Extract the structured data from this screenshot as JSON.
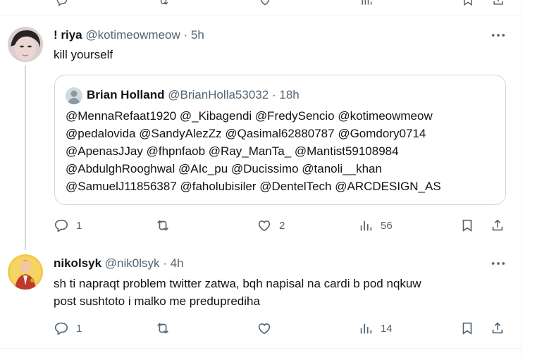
{
  "tweets": [
    {
      "display_name": "! riya",
      "handle": "@kotimeowmeow",
      "separator": "·",
      "time": "5h",
      "text": "kill yourself",
      "quote": {
        "display_name": "Brian Holland",
        "handle": "@BrianHolla53032",
        "separator": "·",
        "time": "18h",
        "lines": [
          "@MennaRefaat1920 @_Kibagendi @FredySencio @kotimeowmeow",
          "@pedalovida @SandyAlezZz @Qasimal62880787 @Gomdory0714",
          "@ApenasJJay @fhpnfaob @Ray_ManTa_ @Mantist59108984",
          "@AbdulghRooghwal @AIc_pu @Ducissimo @tanoli__khan",
          "@SamuelJ11856387 @faholubisiler @DentelTech @ARCDESIGN_AS"
        ]
      },
      "replies": "1",
      "retweets": "",
      "likes": "2",
      "views": "56"
    },
    {
      "display_name": "nikolsyk",
      "handle": "@nik0lsyk",
      "separator": "·",
      "time": "4h",
      "text_lines": [
        "sh ti napraqt problem twitter zatwa, bqh napisal na cardi b pod nqkuw",
        "post sushtoto i malko me preduprediha"
      ],
      "replies": "1",
      "retweets": "",
      "likes": "",
      "views": "14"
    }
  ],
  "icons": {
    "reply": "reply-icon",
    "retweet": "retweet-icon",
    "like": "heart-icon",
    "views": "views-icon",
    "bookmark": "bookmark-icon",
    "share": "share-icon",
    "more": "more-icon"
  },
  "colors": {
    "text": "#0f1419",
    "secondary": "#536471",
    "border": "#cfd9de",
    "divider": "#eff3f4"
  }
}
